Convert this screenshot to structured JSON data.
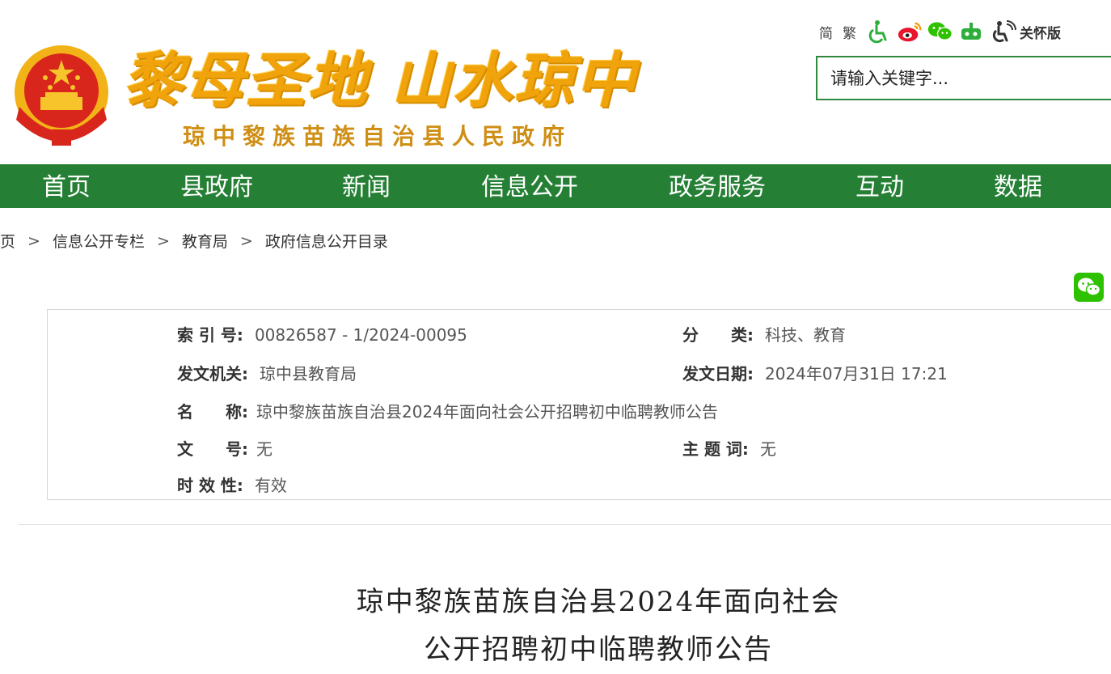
{
  "header": {
    "slogan": "黎母圣地 山水琼中",
    "gov_name": "琼中黎族苗族自治县人民政府"
  },
  "toolbar": {
    "simplified": "简",
    "traditional": "繁",
    "care_mode": "关怀版"
  },
  "search": {
    "placeholder": "请输入关键字..."
  },
  "nav": {
    "items": [
      "首页",
      "县政府",
      "新闻",
      "信息公开",
      "政务服务",
      "互动",
      "数据"
    ]
  },
  "breadcrumb": {
    "sep": ">",
    "items": [
      "页",
      "信息公开专栏",
      "教育局",
      "政府信息公开目录"
    ]
  },
  "meta": {
    "index_label": "索 引 号:",
    "index_value": "00826587 - 1/2024-00095",
    "category_label": "分　　类:",
    "category_value": "科技、教育",
    "issuer_label": "发文机关:",
    "issuer_value": "琼中县教育局",
    "date_label": "发文日期:",
    "date_value": "2024年07月31日 17:21",
    "name_label": "名　　称:",
    "name_value": "琼中黎族苗族自治县2024年面向社会公开招聘初中临聘教师公告",
    "docno_label": "文　　号:",
    "docno_value": "无",
    "subject_label": "主 题 词:",
    "subject_value": "无",
    "validity_label": "时 效 性:",
    "validity_value": "有效"
  },
  "article": {
    "title_line1": "琼中黎族苗族自治县2024年面向社会",
    "title_line2": "公开招聘初中临聘教师公告"
  },
  "colors": {
    "nav_green": "#258035",
    "slogan_gold": "#f0a30a",
    "wechat_green": "#2dc100"
  }
}
